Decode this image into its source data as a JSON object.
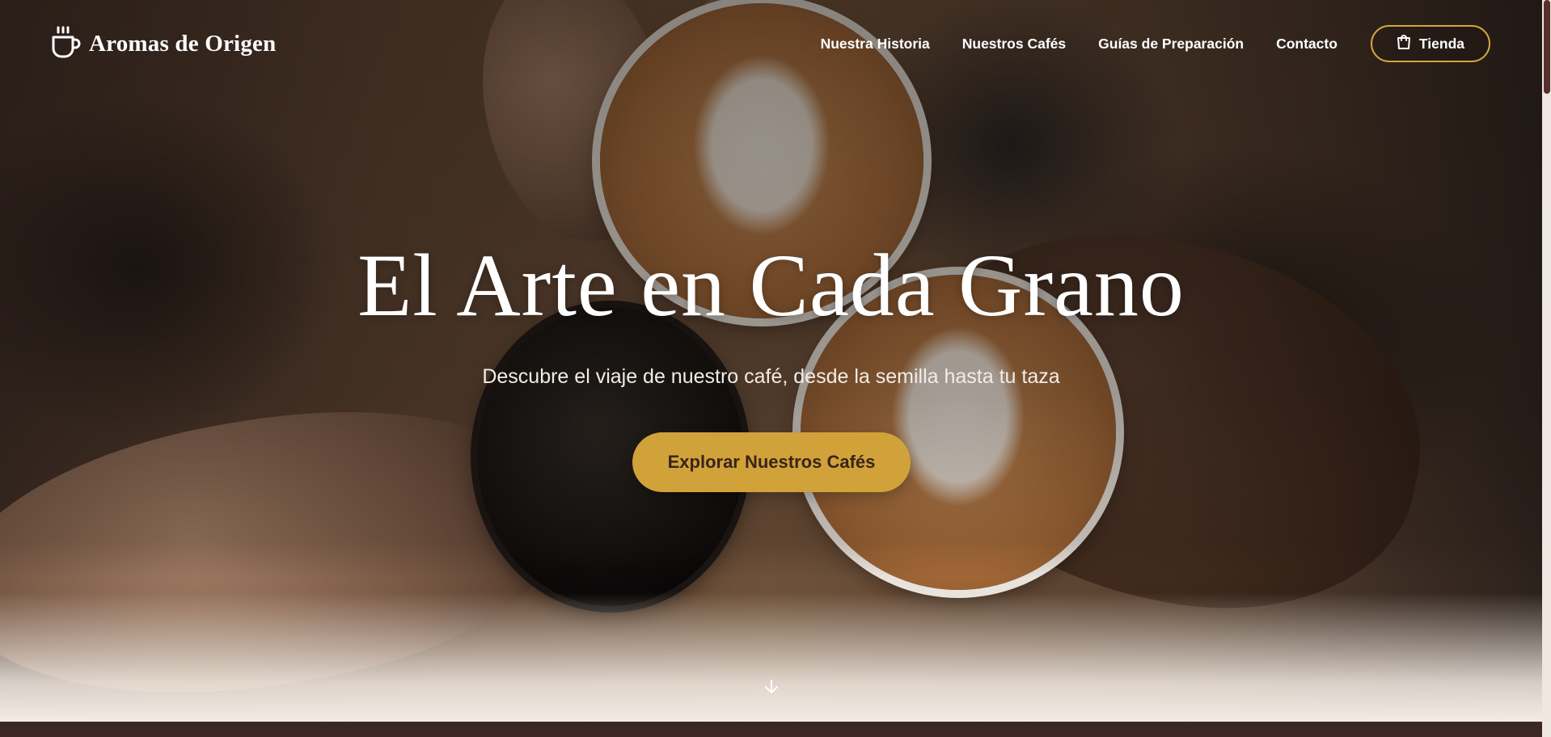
{
  "brand": {
    "name": "Aromas de Origen",
    "icon": "coffee-cup-icon"
  },
  "nav": {
    "items": [
      {
        "label": "Nuestra Historia"
      },
      {
        "label": "Nuestros Cafés"
      },
      {
        "label": "Guías de Preparación"
      },
      {
        "label": "Contacto"
      }
    ],
    "shop": {
      "label": "Tienda",
      "icon": "shopping-bag-icon"
    }
  },
  "hero": {
    "title": "El Arte en Cada Grano",
    "subtitle": "Descubre el viaje de nuestro café, desde la semilla hasta tu taza",
    "cta_label": "Explorar Nuestros Cafés",
    "scroll_icon": "arrow-down-icon"
  },
  "colors": {
    "accent": "#d1a23a",
    "accent_text": "#3a2418",
    "section_dark": "#3d2724",
    "scroll_thumb": "#5a2e2c"
  }
}
